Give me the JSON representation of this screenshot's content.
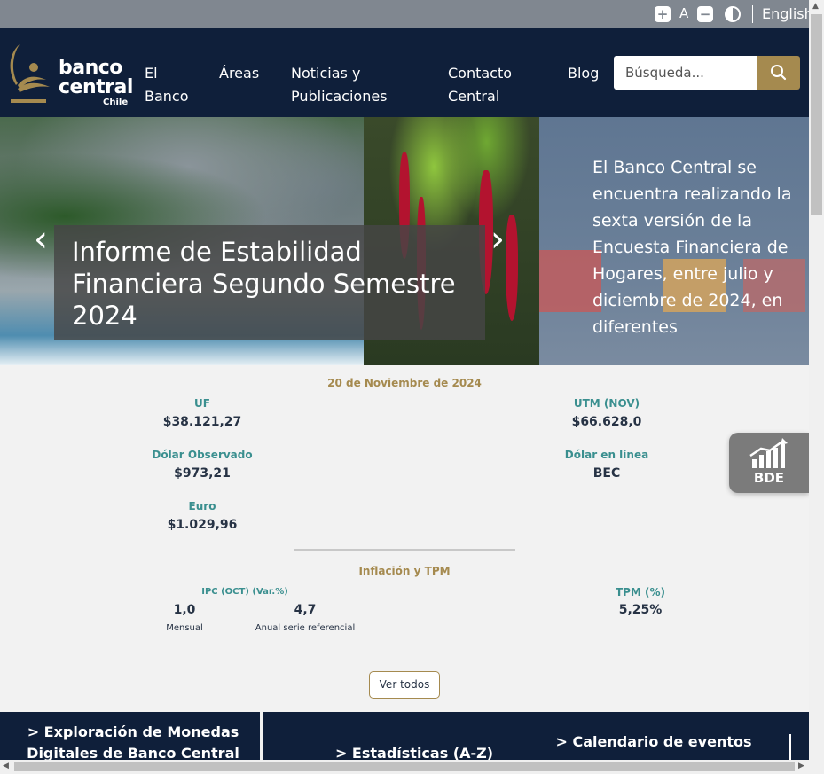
{
  "utility": {
    "zoom_in_icon": "plus-icon",
    "font_label": "A",
    "zoom_out_icon": "minus-icon",
    "contrast_icon": "contrast-icon",
    "language": "English"
  },
  "header": {
    "logo_line1": "banco",
    "logo_line2": "central",
    "logo_line3": "Chile",
    "nav": [
      {
        "label": "El\nBanco"
      },
      {
        "label": "Áreas"
      },
      {
        "label": "Noticias y\nPublicaciones"
      },
      {
        "label": "Contacto\nCentral"
      },
      {
        "label": "Blog"
      }
    ],
    "search_placeholder": "Búsqueda..."
  },
  "hero": {
    "caption": "Informe de Estabilidad Financiera Segundo Semestre 2024",
    "side_text": "El Banco Central se encuentra realizando la sexta versión de la Encuesta Financiera de Hogares, entre julio y diciembre de 2024, en diferentes"
  },
  "indicators": {
    "date": "20 de Noviembre de 2024",
    "uf_label": "UF",
    "uf_value": "$38.121,27",
    "utm_label": "UTM (NOV)",
    "utm_value": "$66.628,0",
    "dolar_obs_label": "Dólar Observado",
    "dolar_obs_value": "$973,21",
    "dolar_linea_label": "Dólar en línea",
    "dolar_linea_value": "BEC",
    "euro_label": "Euro",
    "euro_value": "$1.029,96"
  },
  "inflation": {
    "title": "Inflación y TPM",
    "ipc_label": "IPC (OCT) (Var.%)",
    "ipc_monthly_value": "1,0",
    "ipc_monthly_label": "Mensual",
    "ipc_annual_value": "4,7",
    "ipc_annual_label": "Anual serie referencial",
    "tpm_label": "TPM (%)",
    "tpm_value": "5,25%"
  },
  "ver_todos": "Ver todos",
  "bde_label": "BDE",
  "bottom": {
    "item1": "> Exploración de Monedas Digitales de Banco Central",
    "item2": "> Estadísticas (A-Z)",
    "item3": "> Calendario de eventos"
  }
}
